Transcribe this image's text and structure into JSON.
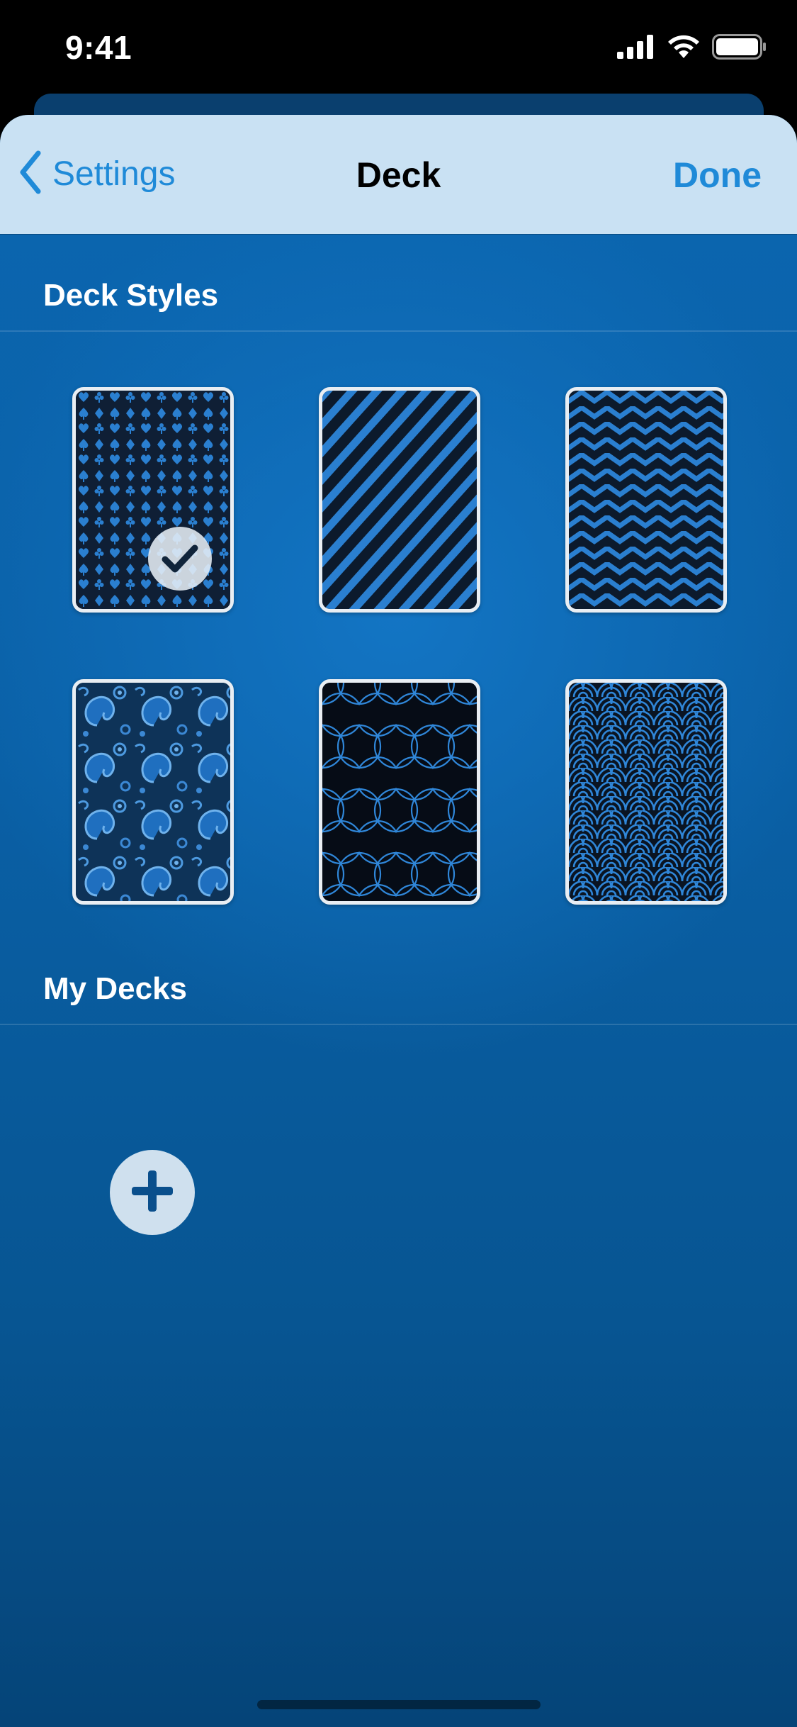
{
  "status_bar": {
    "time": "9:41"
  },
  "nav": {
    "back_label": "Settings",
    "title": "Deck",
    "done_label": "Done"
  },
  "sections": {
    "deck_styles": "Deck Styles",
    "my_decks": "My Decks"
  },
  "deck_styles": [
    {
      "name": "card-suits-pattern",
      "selected": true
    },
    {
      "name": "diagonal-stripes-pattern",
      "selected": false
    },
    {
      "name": "chevron-pattern",
      "selected": false
    },
    {
      "name": "paisley-pattern",
      "selected": false
    },
    {
      "name": "flower-of-life-pattern",
      "selected": false
    },
    {
      "name": "seigaiha-waves-pattern",
      "selected": false
    }
  ],
  "colors": {
    "accent": "#1f8ad8",
    "navbar_bg": "#c9e1f3",
    "background": "#0b66b0",
    "pattern_blue": "#2a7fd0"
  },
  "icons": [
    "chevron-left-icon",
    "signal-icon",
    "wifi-icon",
    "battery-icon",
    "checkmark-icon",
    "plus-icon"
  ]
}
